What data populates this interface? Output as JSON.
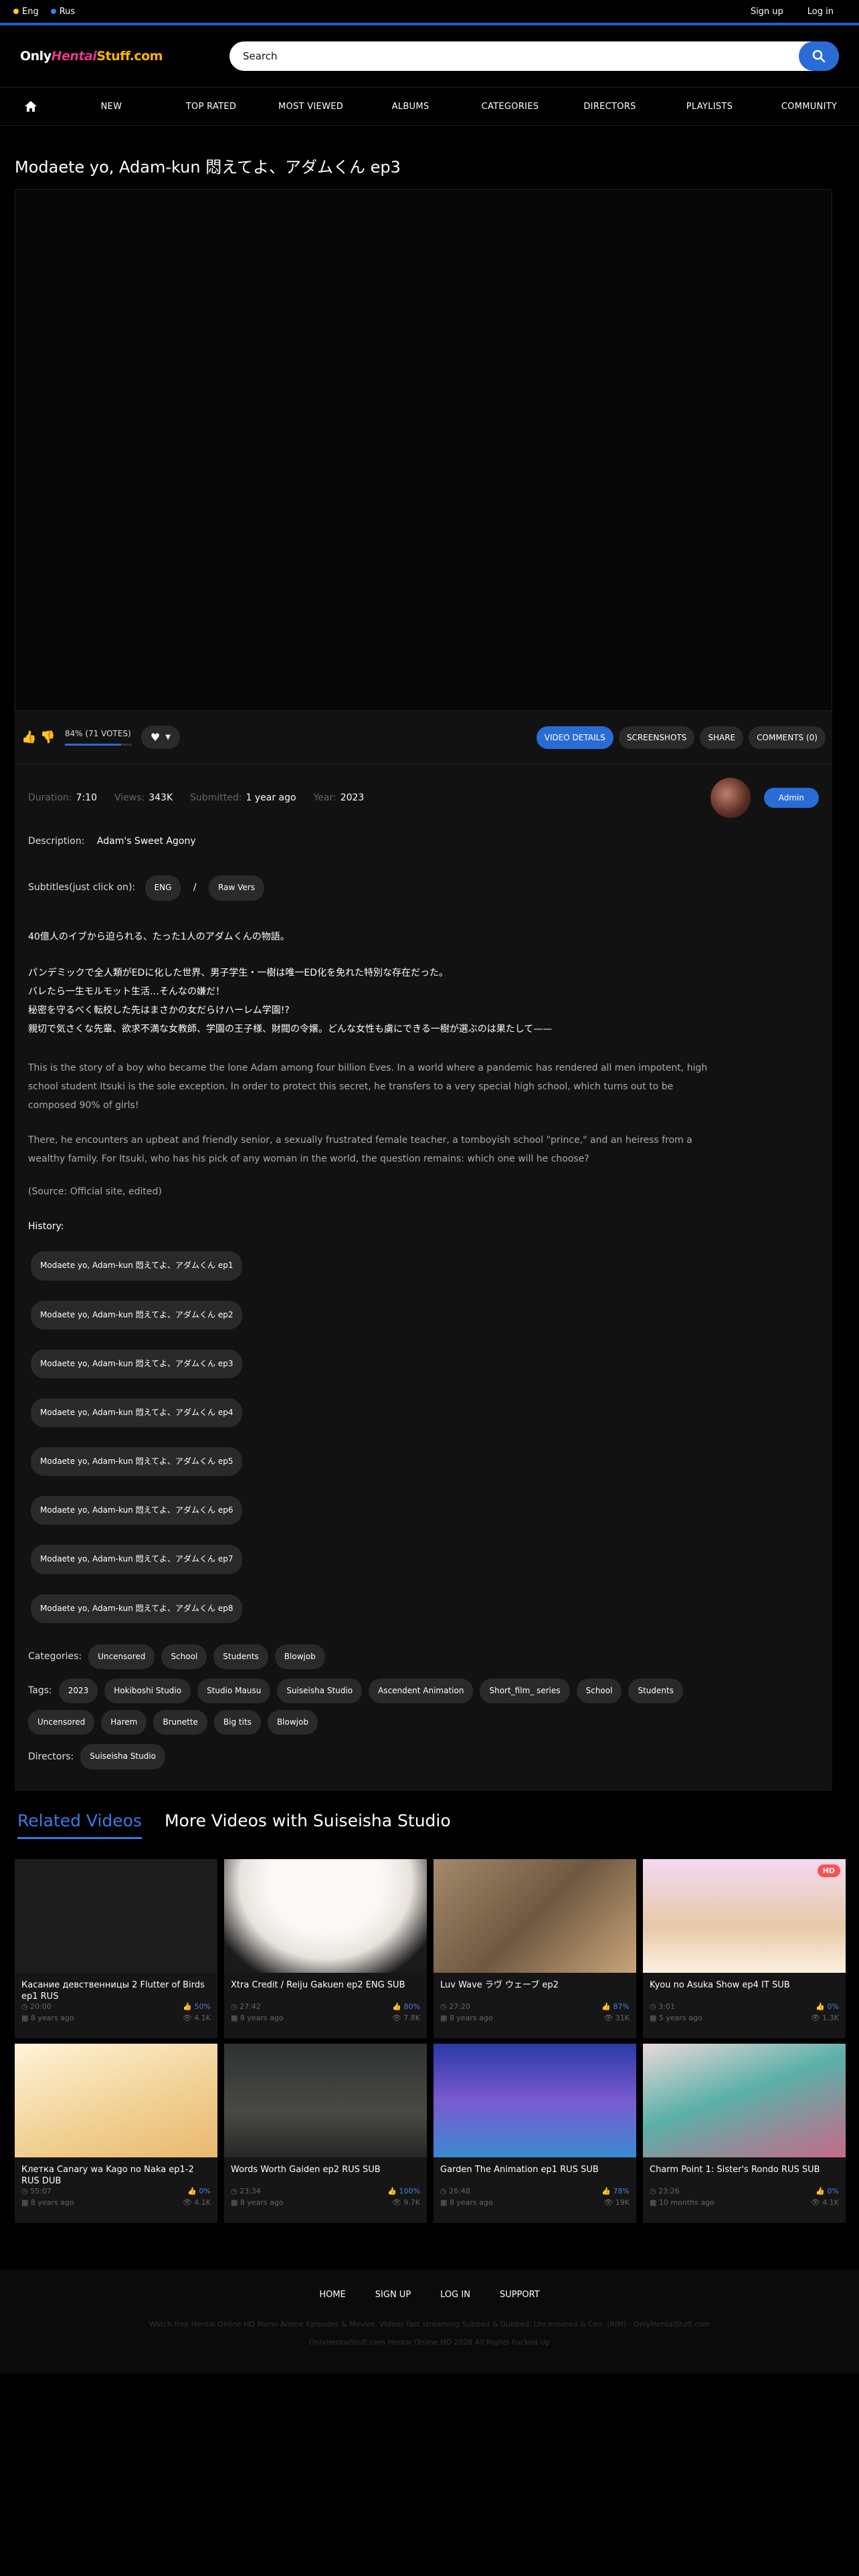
{
  "topbar": {
    "languages": [
      {
        "label": "Eng",
        "color": "#ffd200"
      },
      {
        "label": "Rus",
        "color": "#3a7be8"
      }
    ],
    "sign_up": "Sign up",
    "log_in": "Log in"
  },
  "header": {
    "logo_a": "Only",
    "logo_b": "Hentai",
    "logo_c": "Stuff.com",
    "search_placeholder": "Search"
  },
  "nav": {
    "items": [
      "NEW",
      "TOP RATED",
      "MOST VIEWED",
      "ALBUMS",
      "CATEGORIES",
      "DIRECTORS",
      "PLAYLISTS",
      "COMMUNITY"
    ]
  },
  "video": {
    "title": "Modaete yo, Adam-kun 悶えてよ、アダムくん ep3",
    "rating_text": "84% (71 VOTES)",
    "rating_fraction": 0.84,
    "tabs": [
      "VIDEO DETAILS",
      "SCREENSHOTS",
      "SHARE",
      "COMMENTS (0)"
    ],
    "duration_label": "Duration:",
    "duration": "7:10",
    "views_label": "Views:",
    "views": "343K",
    "submitted_label": "Submitted:",
    "submitted": "1 year ago",
    "year_label": "Year:",
    "year": "2023",
    "admin_label": "Admin",
    "description_label": "Description:",
    "description": "Adam's Sweet Agony",
    "subtitles_label": "Subtitles(just click on):",
    "sub_eng": "ENG",
    "sub_sep": "/",
    "sub_raw": "Raw Vers",
    "jp_line1": "40億人のイブから迫られる、たった1人のアダムくんの物語。",
    "jp_line2": "パンデミックで全人類がEDに化した世界、男子学生・一樹は唯一ED化を免れた特別な存在だった。",
    "jp_line3": "バレたら一生モルモット生活…そんなの嫌だ！",
    "jp_line4": "秘密を守るべく転校した先はまさかの女だらけハーレム学園!?",
    "jp_line5": "親切で気さくな先輩、欲求不満な女教師、学園の王子様、財閥の令嬢。どんな女性も虜にできる一樹が選ぶのは果たして——",
    "en_para1": "This is the story of a boy who became the lone Adam among four billion Eves. In a world where a pandemic has rendered all men impotent, high school student Itsuki is the sole exception. In order to protect this secret, he transfers to a very special high school, which turns out to be composed 90% of girls!",
    "en_para2": "There, he encounters an upbeat and friendly senior, a sexually frustrated female teacher, a tomboyish school \"prince,\" and an heiress from a wealthy family. For Itsuki, who has his pick of any woman in the world, the question remains: which one will he choose?",
    "source": "(Source: Official site, edited)",
    "history_label": "History:",
    "history": [
      "Modaete yo, Adam-kun 悶えてよ、アダムくん ep1",
      "Modaete yo, Adam-kun 悶えてよ、アダムくん ep2",
      "Modaete yo, Adam-kun 悶えてよ、アダムくん ep3",
      "Modaete yo, Adam-kun 悶えてよ、アダムくん ep4",
      "Modaete yo, Adam-kun 悶えてよ、アダムくん ep5",
      "Modaete yo, Adam-kun 悶えてよ、アダムくん ep6",
      "Modaete yo, Adam-kun 悶えてよ、アダムくん ep7",
      "Modaete yo, Adam-kun 悶えてよ、アダムくん ep8"
    ],
    "categories_label": "Categories:",
    "categories": [
      "Uncensored",
      "School",
      "Students",
      "Blowjob"
    ],
    "tags_label": "Tags:",
    "tags": [
      "2023",
      "Hokiboshi Studio",
      "Studio Mausu",
      "Suiseisha Studio",
      "Ascendent Animation",
      "Short_film_ series",
      "School",
      "Students",
      "Uncensored",
      "Harem",
      "Brunette",
      "Big tits",
      "Blowjob"
    ],
    "directors_label": "Directors:",
    "directors": [
      "Suiseisha Studio"
    ]
  },
  "related": {
    "tab_related": "Related Videos",
    "tab_more": "More Videos with Suiseisha Studio",
    "cards": [
      {
        "title": "Касание девственницы 2 Flutter of Birds ep1 RUS",
        "duration": "20:00",
        "rating": "50%",
        "age": "8 years ago",
        "views": "4.1K",
        "hd": "",
        "thumb": "#1c1c1c"
      },
      {
        "title": "Xtra Credit / Reiju Gakuen ep2 ENG SUB",
        "duration": "27:42",
        "rating": "80%",
        "age": "8 years ago",
        "views": "7.8K",
        "hd": "",
        "thumb": "#f2eeea"
      },
      {
        "title": "Luv Wave ラヴ ウェーブ ep2",
        "duration": "27:20",
        "rating": "87%",
        "age": "8 years ago",
        "views": "31K",
        "hd": "",
        "thumb": "#8a6e52"
      },
      {
        "title": "Kyou no Asuka Show ep4 IT SUB",
        "duration": "3:01",
        "rating": "0%",
        "age": "5 years ago",
        "views": "1.3K",
        "hd": "HD",
        "thumb": "#e8d9f0"
      },
      {
        "title": "Клетка Canary wa Kago no Naka ep1-2 RUS DUB",
        "duration": "55:07",
        "rating": "0%",
        "age": "8 years ago",
        "views": "4.1K",
        "hd": "",
        "thumb": "#f3dcae"
      },
      {
        "title": "Words Worth Gaiden ep2 RUS SUB",
        "duration": "23:34",
        "rating": "100%",
        "age": "8 years ago",
        "views": "9.7K",
        "hd": "",
        "thumb": "#3a3a3a"
      },
      {
        "title": "Garden The Animation ep1 RUS SUB",
        "duration": "26:48",
        "rating": "78%",
        "age": "8 years ago",
        "views": "19K",
        "hd": "",
        "thumb": "#5a64c8"
      },
      {
        "title": "Charm Point 1: Sister's Rondo RUS SUB",
        "duration": "23:26",
        "rating": "0%",
        "age": "10 months ago",
        "views": "4.1K",
        "hd": "",
        "thumb": "#6ab0a8"
      }
    ]
  },
  "footer": {
    "links": [
      "HOME",
      "SIGN UP",
      "LOG IN",
      "SUPPORT"
    ],
    "desc": "Watch free Hentai Online HD Porno Anime Episodes & Movies. Videos fast streaming Subbed & Dubbed. Uncensored & Cen. (RIM) - OnlyHentaiStuff.com",
    "copy": "OnlyHentaiStuff.com Hentai Online HD 2026 All Rights Fucked Up"
  }
}
